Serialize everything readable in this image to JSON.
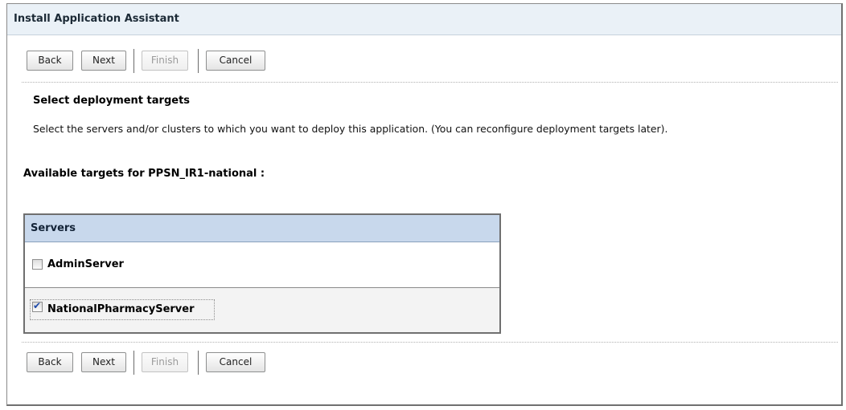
{
  "window": {
    "title": "Install Application Assistant"
  },
  "buttons": {
    "back": "Back",
    "next": "Next",
    "finish": "Finish",
    "cancel": "Cancel"
  },
  "section": {
    "title": "Select deployment targets",
    "instructions": "Select the servers and/or clusters to which you want to deploy this application. (You can reconfigure deployment targets later)."
  },
  "targets": {
    "label": "Available targets for PPSN_IR1-national :"
  },
  "servers_table": {
    "header": "Servers",
    "rows": [
      {
        "name": "AdminServer",
        "checked": false
      },
      {
        "name": "NationalPharmacyServer",
        "checked": true
      }
    ]
  }
}
